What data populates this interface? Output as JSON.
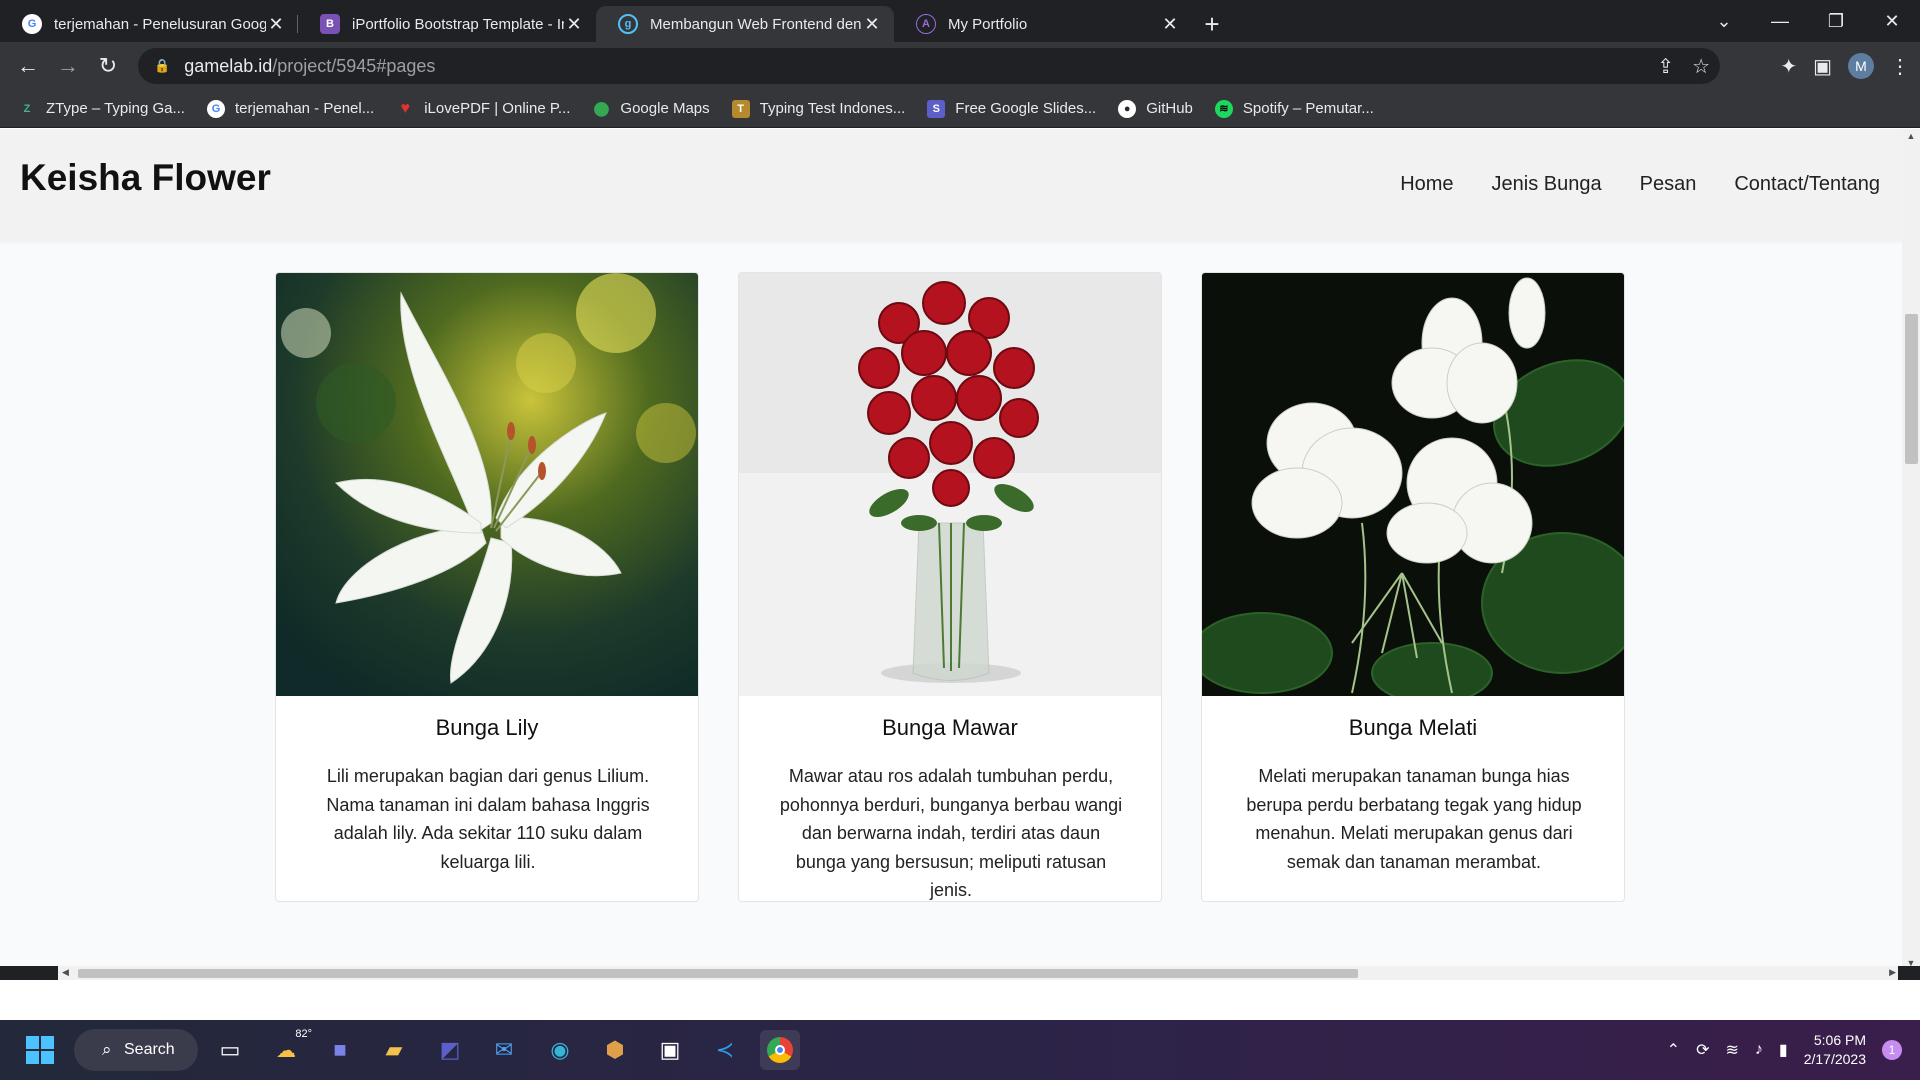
{
  "browser": {
    "tabs": [
      {
        "title": "terjemahan - Penelusuran Google",
        "icon": "google-icon",
        "active": false
      },
      {
        "title": "iPortfolio Bootstrap Template - Index",
        "icon": "bootstrap-icon",
        "active": false
      },
      {
        "title": "Membangun Web Frontend dengan",
        "icon": "gamelab-icon",
        "active": true
      },
      {
        "title": "My Portfolio",
        "icon": "portfolio-icon",
        "active": false
      }
    ],
    "url_host": "gamelab.id",
    "url_path": "/project/5945#pages",
    "profile_initial": "M",
    "bookmarks": [
      {
        "label": "ZType – Typing Ga...",
        "color": "#3fb68b"
      },
      {
        "label": "terjemahan - Penel...",
        "color": "#4285f4"
      },
      {
        "label": "iLovePDF | Online P...",
        "color": "#e5322d"
      },
      {
        "label": "Google Maps",
        "color": "#34a853"
      },
      {
        "label": "Typing Test Indones...",
        "color": "#b58a2c"
      },
      {
        "label": "Free Google Slides...",
        "color": "#5b5fc7"
      },
      {
        "label": "GitHub",
        "color": "#ffffff"
      },
      {
        "label": "Spotify – Pemutar...",
        "color": "#1ed760"
      }
    ]
  },
  "site": {
    "brand": "Keisha Flower",
    "nav": [
      "Home",
      "Jenis Bunga",
      "Pesan",
      "Contact/Tentang"
    ],
    "cards": [
      {
        "title": "Bunga Lily",
        "text": "Lili merupakan bagian dari genus Lilium. Nama tanaman ini dalam bahasa Inggris adalah lily. Ada sekitar 110 suku dalam keluarga lili."
      },
      {
        "title": "Bunga Mawar",
        "text": "Mawar atau ros adalah tumbuhan perdu, pohonnya berduri, bunganya berbau wangi dan berwarna indah, terdiri atas daun bunga yang bersusun; meliputi ratusan jenis."
      },
      {
        "title": "Bunga Melati",
        "text": "Melati merupakan tanaman bunga hias berupa perdu berbatang tegak yang hidup menahun. Melati merupakan genus dari semak dan tanaman merambat."
      }
    ]
  },
  "taskbar": {
    "search_label": "Search",
    "weather": "82°",
    "time": "5:06 PM",
    "date": "2/17/2023",
    "notifications": "1"
  }
}
